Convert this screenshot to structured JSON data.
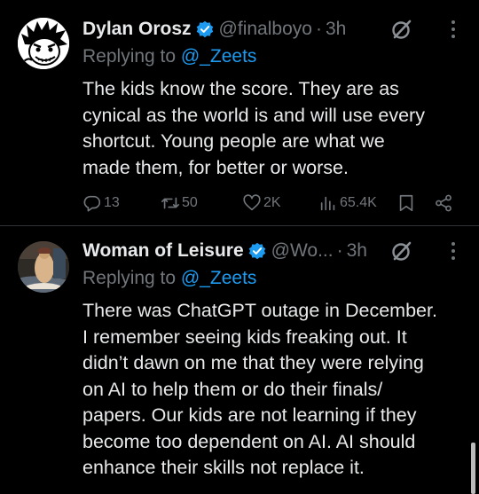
{
  "tweets": [
    {
      "name": "Dylan Orosz",
      "handle": "@finalboyo",
      "time": "3h",
      "replying_prefix": "Replying to ",
      "replying_to": "@_Zeets",
      "text": "The kids know the score. They are as\ncynical as the world is and will use every\nshortcut. Young people are what we\nmade them, for better or worse.",
      "replies": "13",
      "reposts": "50",
      "likes": "2K",
      "views": "65.4K"
    },
    {
      "name": "Woman of Leisure",
      "handle": "@Wo...",
      "time": "3h",
      "replying_prefix": "Replying to ",
      "replying_to": "@_Zeets",
      "text": "There was ChatGPT outage in December.\nI remember seeing kids freaking out. It\ndidn’t dawn on me that they were relying\non AI to help them or do their finals/\npapers. Our kids are not learning if they\nbecome too dependent on AI. AI should\nenhance their skills not replace it."
    }
  ],
  "colors": {
    "background": "#000000",
    "text": "#e7e9ea",
    "muted": "#71767b",
    "link": "#1d9bf0",
    "divider": "#2f3336"
  }
}
